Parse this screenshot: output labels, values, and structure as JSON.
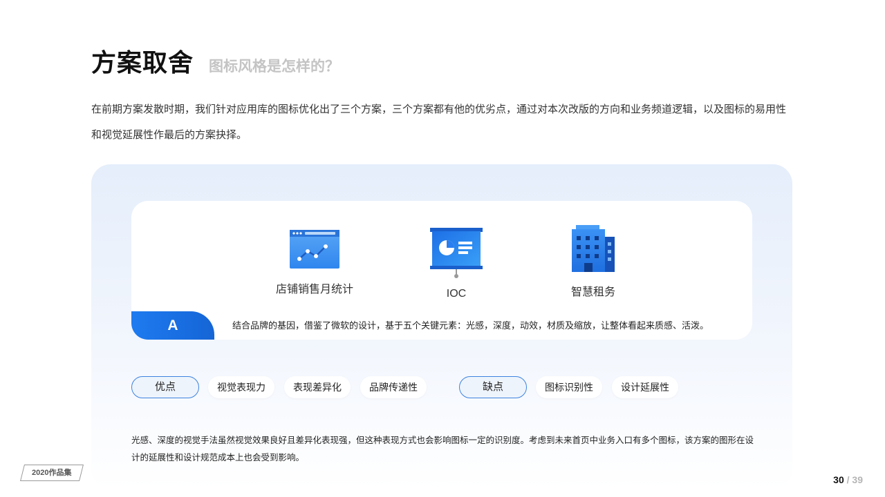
{
  "header": {
    "title": "方案取舍",
    "subtitle": "图标风格是怎样的？"
  },
  "intro": {
    "text": "在前期方案发散时期，我们针对应用库的图标优化出了三个方案，三个方案都有他的优劣点，通过对本次改版的方向和业务频道逻辑，以及图标的易用性和视觉延展性作最后的方案抉择。"
  },
  "card": {
    "icons": [
      {
        "label": "店铺销售月统计",
        "icon": "sales-chart-icon"
      },
      {
        "label": "IOC",
        "icon": "presentation-board-icon"
      },
      {
        "label": "智慧租务",
        "icon": "office-building-icon"
      }
    ],
    "tag": "A",
    "description": "结合品牌的基因，借鉴了微软的设计，基于五个关键元素：光感，深度，动效，材质及缩放，让整体看起来质感、活泼。",
    "colors": {
      "accent": "#1e7bf0",
      "icon_blue": "#2b8af0"
    }
  },
  "pros": {
    "label": "优点",
    "items": [
      "视觉表现力",
      "表现差异化",
      "品牌传递性"
    ]
  },
  "cons": {
    "label": "缺点",
    "items": [
      "图标识别性",
      "设计延展性"
    ]
  },
  "summary": {
    "text": "光感、深度的视觉手法虽然视觉效果良好且差异化表现强，但这种表现方式也会影响图标一定的识别度。考虑到未来首页中业务入口有多个图标，该方案的图形在设计的延展性和设计规范成本上也会受到影响。"
  },
  "footer": {
    "badge": "2020作品集",
    "page_current": "30",
    "page_separator": "/",
    "page_total": "39"
  }
}
